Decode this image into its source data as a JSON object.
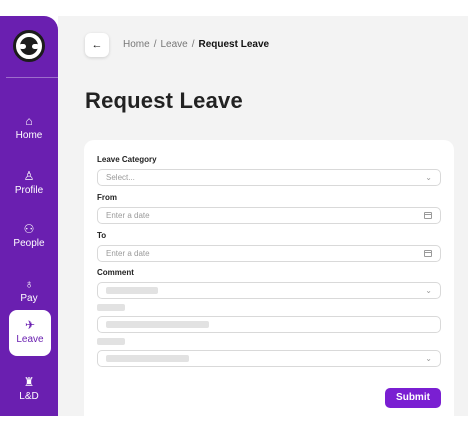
{
  "sidebar": {
    "logo_icon": "logo-icon",
    "items": [
      {
        "label": "Home",
        "icon": "home-icon",
        "glyph": "⌂"
      },
      {
        "label": "Profile",
        "icon": "profile-icon",
        "glyph": "♙"
      },
      {
        "label": "People",
        "icon": "people-icon",
        "glyph": "⚇"
      },
      {
        "label": "Pay",
        "icon": "pay-icon",
        "glyph": "♁"
      },
      {
        "label": "Leave",
        "icon": "plane-icon",
        "glyph": "✈",
        "active": true
      },
      {
        "label": "L&D",
        "icon": "learning-icon",
        "glyph": "♜"
      }
    ]
  },
  "header": {
    "back_glyph": "←",
    "breadcrumb": [
      "Home",
      "Leave",
      "Request Leave"
    ],
    "separator": "/"
  },
  "page": {
    "title": "Request Leave"
  },
  "form": {
    "category_label": "Leave Category",
    "category_placeholder": "Select...",
    "from_label": "From",
    "from_placeholder": "Enter a date",
    "to_label": "To",
    "to_placeholder": "Enter a date",
    "comment_label": "Comment",
    "submit_label": "Submit",
    "chevron": "⌄"
  },
  "colors": {
    "accent": "#7a1fd2",
    "sidebar": "#6a1fb0"
  }
}
